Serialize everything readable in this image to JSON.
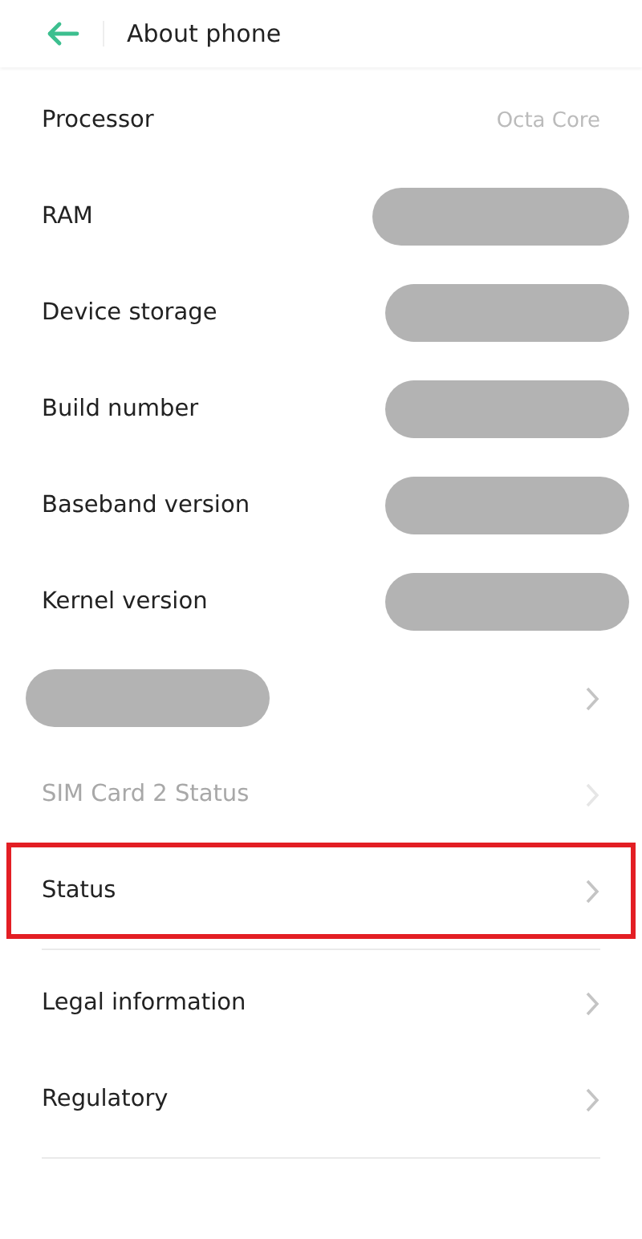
{
  "header": {
    "title": "About phone"
  },
  "sections": [
    {
      "items": [
        {
          "kind": "info",
          "label": "Processor",
          "value": "Octa Core",
          "redacted": false
        },
        {
          "kind": "info",
          "label": "RAM",
          "redacted": true
        },
        {
          "kind": "info",
          "label": "Device storage",
          "redacted": true
        },
        {
          "kind": "info",
          "label": "Build number",
          "redacted": true
        },
        {
          "kind": "info",
          "label": "Baseband version",
          "redacted": true
        },
        {
          "kind": "info",
          "label": "Kernel version",
          "redacted": true
        },
        {
          "kind": "link",
          "redacted": true,
          "disabled": false,
          "highlighted": false
        },
        {
          "kind": "link",
          "label": "SIM Card 2 Status",
          "redacted": false,
          "disabled": true,
          "highlighted": false
        },
        {
          "kind": "link",
          "label": "Status",
          "redacted": false,
          "disabled": false,
          "highlighted": true
        }
      ]
    },
    {
      "items": [
        {
          "kind": "link",
          "label": "Legal information",
          "redacted": false,
          "disabled": false,
          "highlighted": false
        },
        {
          "kind": "link",
          "label": "Regulatory",
          "redacted": false,
          "disabled": false,
          "highlighted": false
        }
      ]
    }
  ]
}
